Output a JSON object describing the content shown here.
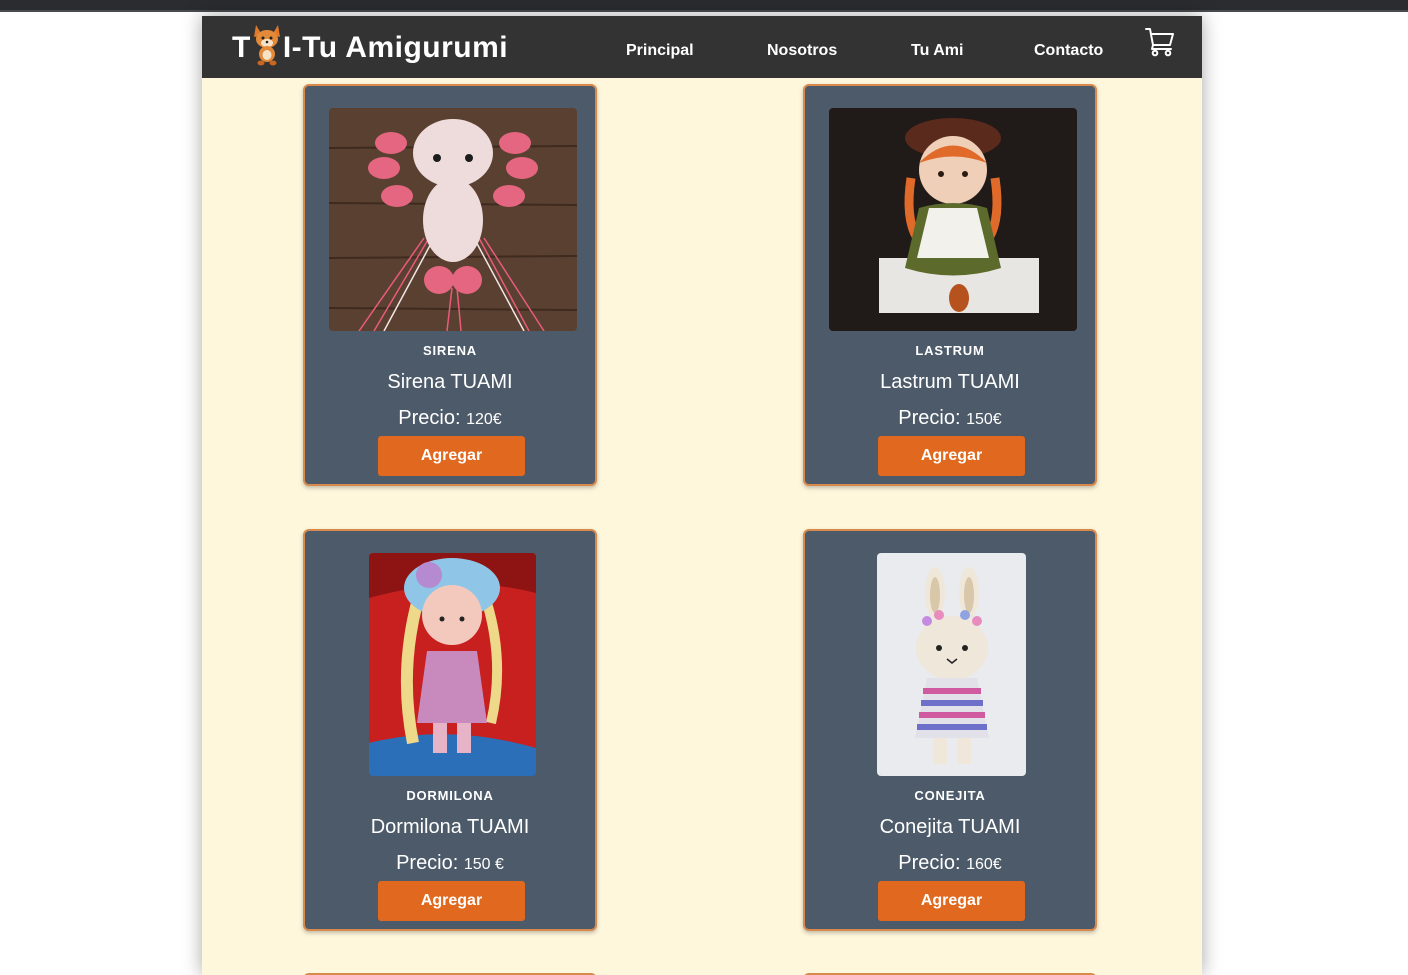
{
  "brand": {
    "prefix": "T",
    "suffix": "I-Tu Amigurumi",
    "logo_icon": "fox-icon"
  },
  "nav": {
    "links": [
      "Principal",
      "Nosotros",
      "Tu Ami",
      "Contacto"
    ],
    "cart_icon": "cart-icon"
  },
  "products": [
    {
      "tag": "SIRENA",
      "name": "Sirena TUAMI",
      "price_label": "Precio:",
      "price": "120€",
      "button": "Agregar"
    },
    {
      "tag": "LASTRUM",
      "name": "Lastrum TUAMI",
      "price_label": "Precio:",
      "price": "150€",
      "button": "Agregar"
    },
    {
      "tag": "DORMILONA",
      "name": "Dormilona TUAMI",
      "price_label": "Precio:",
      "price": "150 €",
      "button": "Agregar"
    },
    {
      "tag": "CONEJITA",
      "name": "Conejita TUAMI",
      "price_label": "Precio:",
      "price": "160€",
      "button": "Agregar"
    }
  ],
  "colors": {
    "navbar": "#333333",
    "page_bg": "#fff7dc",
    "card_bg": "#4c5a69",
    "card_border": "#d88a4d",
    "button": "#e0691f"
  }
}
